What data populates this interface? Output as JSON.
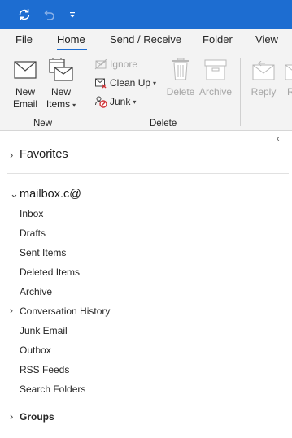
{
  "colors": {
    "accent": "#1d6dd1",
    "ribbon_bg": "#f3f3f3",
    "disabled": "#a6a6a6",
    "junk_red": "#d13438"
  },
  "qat": {
    "icons": [
      "sync-icon",
      "undo-icon",
      "customize-qat-icon"
    ]
  },
  "tabs": [
    {
      "label": "File"
    },
    {
      "label": "Home",
      "active": true
    },
    {
      "label": "Send / Receive"
    },
    {
      "label": "Folder"
    },
    {
      "label": "View"
    }
  ],
  "ribbon": {
    "new_group": {
      "label": "New",
      "new_email": {
        "line1": "New",
        "line2": "Email"
      },
      "new_items": {
        "line1": "New",
        "line2": "Items"
      }
    },
    "delete_group": {
      "label": "Delete",
      "ignore": "Ignore",
      "clean_up": "Clean Up",
      "junk": "Junk",
      "delete": "Delete",
      "archive": "Archive"
    },
    "respond_group": {
      "reply": "Reply",
      "reply_all_partial": "R"
    }
  },
  "folder_pane": {
    "favorites": "Favorites",
    "mailbox": "mailbox.c@",
    "folders": [
      "Inbox",
      "Drafts",
      "Sent Items",
      "Deleted Items",
      "Archive",
      "Conversation History",
      "Junk Email",
      "Outbox",
      "RSS Feeds",
      "Search Folders"
    ],
    "expandable_folder": "Conversation History",
    "groups": "Groups"
  }
}
